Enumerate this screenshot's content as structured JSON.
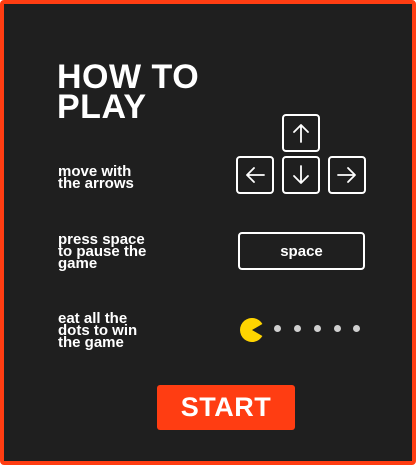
{
  "colors": {
    "panel_background": "#1f1f1f",
    "border": "#ff3d12",
    "accent": "#ff3d12",
    "text": "#ffffff",
    "pacman": "#ffd400",
    "pellet": "#cfcfcf"
  },
  "title": "HOW TO\nPLAY",
  "instructions": {
    "arrows": "move with\nthe arrows",
    "space": "press space\nto pause the\ngame",
    "eat": "eat all the\ndots to win\nthe game"
  },
  "keys": {
    "up_icon": "arrow-up-icon",
    "left_icon": "arrow-left-icon",
    "down_icon": "arrow-down-icon",
    "right_icon": "arrow-right-icon",
    "space_label": "space"
  },
  "demo": {
    "character_icon": "pacman-icon",
    "pellet_icon": "pellet-icon",
    "pellet_count": 5
  },
  "start_label": "START"
}
